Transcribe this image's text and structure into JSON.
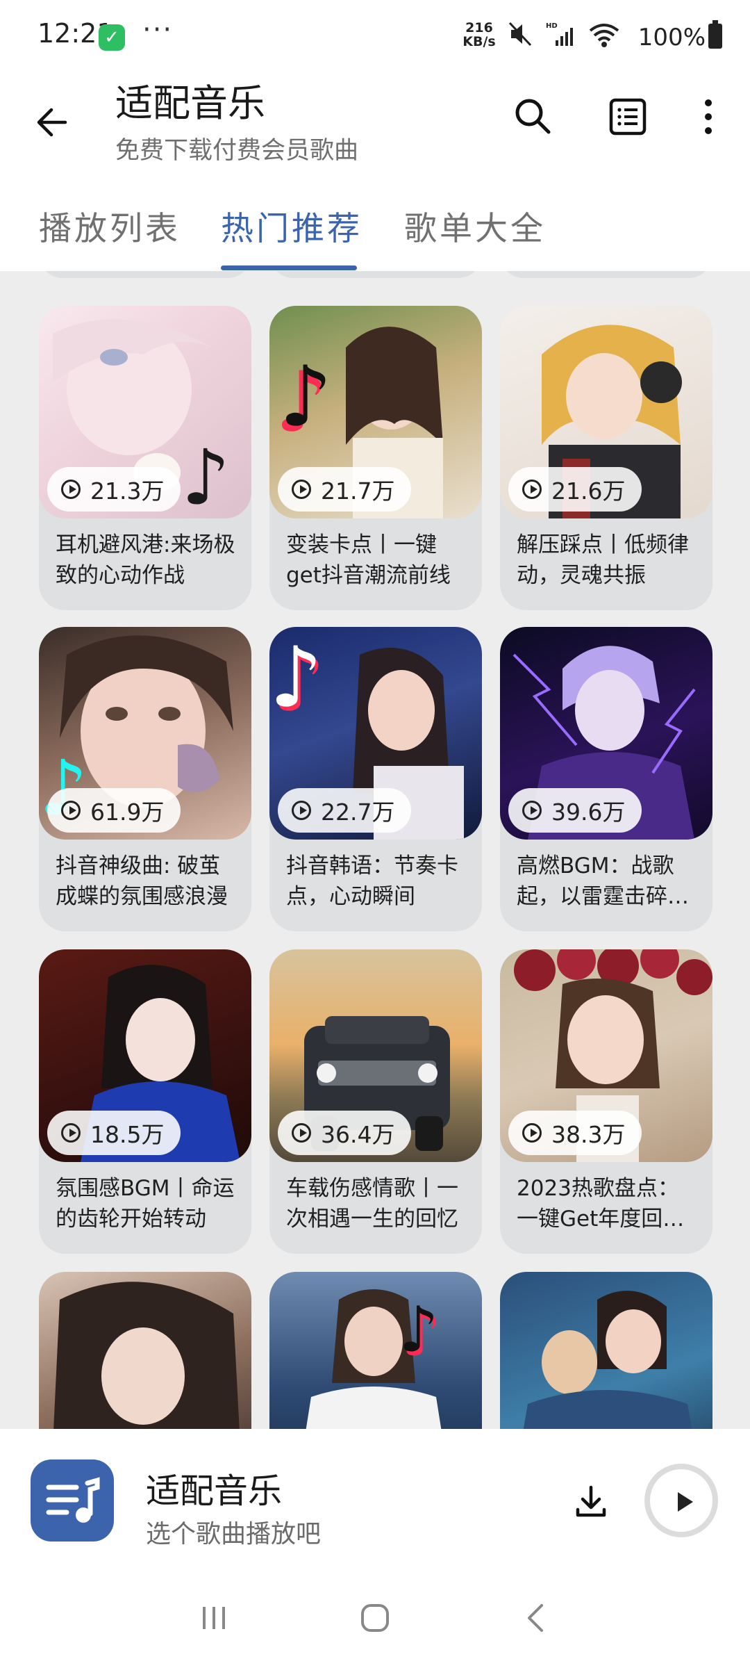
{
  "status_bar": {
    "time": "12:21",
    "more": "···",
    "net_speed_value": "216",
    "net_speed_unit": "KB/s",
    "battery": "100%"
  },
  "header": {
    "title": "适配音乐",
    "subtitle": "免费下载付费会员歌曲"
  },
  "tabs": [
    {
      "label": "播放列表"
    },
    {
      "label": "热门推荐"
    },
    {
      "label": "歌单大全"
    }
  ],
  "active_tab": "热门推荐",
  "playlists": [
    {
      "plays": "21.3万",
      "title": "耳机避风港:来场极致的心动作战"
    },
    {
      "plays": "21.7万",
      "title": "变装卡点丨一键get抖音潮流前线"
    },
    {
      "plays": "21.6万",
      "title": "解压踩点丨低频律动，灵魂共振"
    },
    {
      "plays": "61.9万",
      "title": "抖音神级曲: 破茧成蝶的氛围感浪漫"
    },
    {
      "plays": "22.7万",
      "title": "抖音韩语：节奏卡点，心动瞬间"
    },
    {
      "plays": "39.6万",
      "title": "高燃BGM：战歌起，以雷霆击碎…"
    },
    {
      "plays": "18.5万",
      "title": "氛围感BGM丨命运的齿轮开始转动"
    },
    {
      "plays": "36.4万",
      "title": "车载伤感情歌丨一次相遇一生的回忆"
    },
    {
      "plays": "38.3万",
      "title": "2023热歌盘点：一键Get年度回…"
    }
  ],
  "player": {
    "title": "适配音乐",
    "subtitle": "选个歌曲播放吧"
  },
  "colors": {
    "accent": "#3b64ad",
    "card_bg": "#dfe0e2",
    "content_bg": "#ededed"
  },
  "icons": [
    "back-arrow-icon",
    "search-icon",
    "list-icon",
    "more-vert-icon",
    "play-count-icon",
    "music-note-icon",
    "download-icon",
    "play-icon",
    "recents-icon",
    "home-icon",
    "back-icon"
  ]
}
